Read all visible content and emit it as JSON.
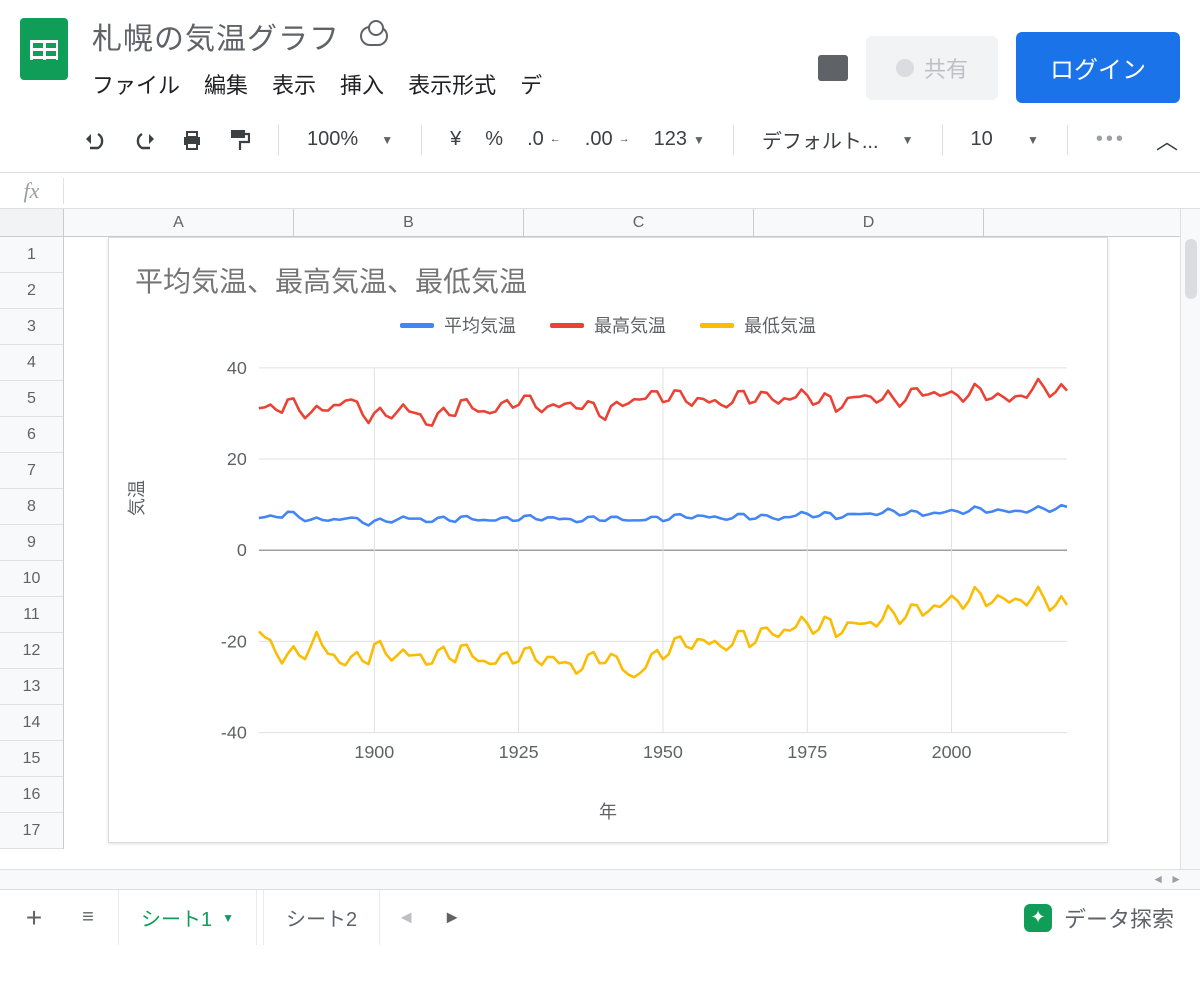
{
  "doc": {
    "title": "札幌の気温グラフ"
  },
  "menubar": {
    "file": "ファイル",
    "edit": "編集",
    "view": "表示",
    "insert": "挿入",
    "format": "表示形式",
    "data_truncated": "デ"
  },
  "header": {
    "share": "共有",
    "login": "ログイン"
  },
  "toolbar": {
    "zoom": "100%",
    "currency": "¥",
    "percent": "%",
    "dec_dec": ".0",
    "dec_inc": ".00",
    "numfmt": "123",
    "font": "デフォルト...",
    "font_size": "10"
  },
  "columns": [
    "A",
    "B",
    "C",
    "D"
  ],
  "rows": [
    "1",
    "2",
    "3",
    "4",
    "5",
    "6",
    "7",
    "8",
    "9",
    "10",
    "11",
    "12",
    "13",
    "14",
    "15",
    "16",
    "17"
  ],
  "sheettabs": {
    "add": "+",
    "all": "≡",
    "tab1": "シート1",
    "tab2": "シート2",
    "explore": "データ探索"
  },
  "chart_data": {
    "type": "line",
    "title": "平均気温、最高気温、最低気温",
    "xlabel": "年",
    "ylabel": "気温",
    "ylim": [
      -40,
      40
    ],
    "x_ticks": [
      1900,
      1925,
      1950,
      1975,
      2000
    ],
    "x_range": [
      1880,
      2020
    ],
    "series": [
      {
        "name": "平均気温",
        "color": "#4285f4",
        "x": [
          1880,
          1885,
          1890,
          1895,
          1900,
          1905,
          1910,
          1915,
          1920,
          1925,
          1930,
          1935,
          1940,
          1945,
          1950,
          1955,
          1960,
          1965,
          1970,
          1975,
          1980,
          1985,
          1990,
          1995,
          2000,
          2005,
          2010,
          2015,
          2020
        ],
        "values": [
          7,
          8,
          6.5,
          7,
          6,
          7,
          6.5,
          7,
          6.5,
          7,
          7,
          6.5,
          7,
          6.5,
          7,
          7.5,
          7,
          7.5,
          7,
          8,
          7.5,
          8,
          8.5,
          8,
          8.5,
          9,
          8.5,
          9,
          9.5
        ]
      },
      {
        "name": "最高気温",
        "color": "#ea4335",
        "x": [
          1880,
          1885,
          1890,
          1895,
          1900,
          1905,
          1910,
          1915,
          1920,
          1925,
          1930,
          1935,
          1940,
          1945,
          1950,
          1955,
          1960,
          1965,
          1970,
          1975,
          1980,
          1985,
          1990,
          1995,
          2000,
          2005,
          2010,
          2015,
          2020
        ],
        "values": [
          31,
          32,
          30,
          33,
          29,
          31,
          28,
          32,
          30,
          33,
          31,
          32,
          30,
          33,
          34,
          33,
          32,
          34,
          33,
          34,
          32,
          34,
          33,
          35,
          34,
          35,
          33,
          36,
          35
        ]
      },
      {
        "name": "最低気温",
        "color": "#fbbc04",
        "x": [
          1880,
          1885,
          1890,
          1895,
          1900,
          1905,
          1910,
          1915,
          1920,
          1925,
          1930,
          1935,
          1940,
          1945,
          1950,
          1955,
          1960,
          1965,
          1970,
          1975,
          1980,
          1985,
          1990,
          1995,
          2000,
          2005,
          2010,
          2015,
          2020
        ],
        "values": [
          -18,
          -24,
          -20,
          -25,
          -22,
          -23,
          -24,
          -22,
          -25,
          -23,
          -24,
          -26,
          -23,
          -28,
          -22,
          -20,
          -21,
          -19,
          -18,
          -16,
          -17,
          -16,
          -14,
          -13,
          -11,
          -10,
          -11,
          -10,
          -12
        ]
      }
    ]
  }
}
